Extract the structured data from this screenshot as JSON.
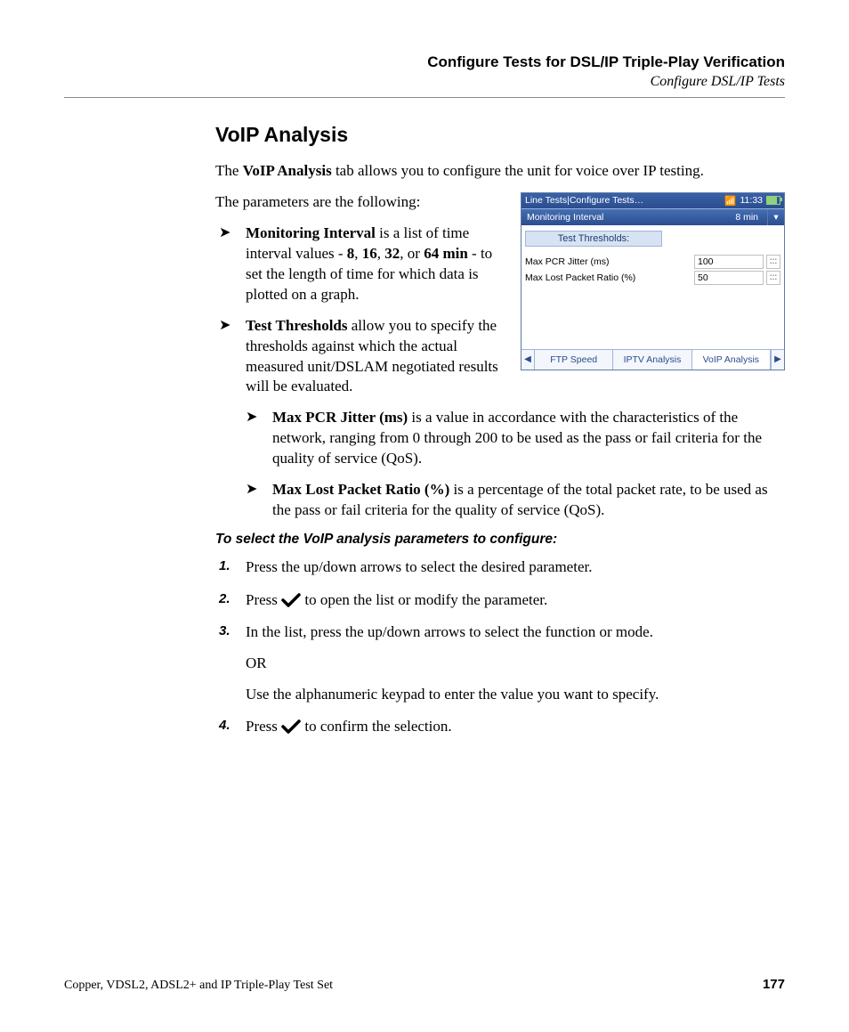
{
  "header": {
    "chapter": "Configure Tests for DSL/IP Triple-Play Verification",
    "section": "Configure DSL/IP Tests"
  },
  "title": "VoIP Analysis",
  "intro_pre": "The ",
  "intro_b": "VoIP Analysis",
  "intro_post": " tab allows you to configure the unit for voice over IP testing.",
  "params_lead": "The parameters are the following:",
  "bullets": {
    "mon_b": "Monitoring Interval",
    "mon_t1": " is a list of time interval values - ",
    "mon_v1": "8",
    "mon_c1": ", ",
    "mon_v2": "16",
    "mon_c2": ", ",
    "mon_v3": "32",
    "mon_c3": ", or ",
    "mon_v4": "64 min",
    "mon_t2": " - to set the length of time for which data is plotted on a graph.",
    "thr_b": "Test Thresholds",
    "thr_t": " allow you to specify the thresholds against which the actual measured unit/DSLAM negotiated results will be evaluated.",
    "pcr_b": "Max PCR Jitter (ms)",
    "pcr_t": " is a value in accordance with the characteristics of the network, ranging from 0 through 200 to be used as the pass or fail criteria for the quality of service (QoS).",
    "lpr_b": "Max Lost Packet Ratio (%)",
    "lpr_t": " is a percentage of the total packet rate, to be used as the pass or fail criteria for the quality of service (QoS)."
  },
  "instr_head": "To select the VoIP analysis parameters to configure:",
  "steps": {
    "s1": "Press the up/down arrows to select the desired parameter.",
    "s2a": "Press ",
    "s2b": " to open the list or modify the parameter.",
    "s3": "In the list, press the up/down arrows to select the function or mode.",
    "s3or": "OR",
    "s3alt": "Use the alphanumeric keypad to enter the value you want to specify.",
    "s4a": "Press ",
    "s4b": " to confirm the selection."
  },
  "device": {
    "breadcrumb": "Line Tests|Configure Tests…",
    "time": "11:33",
    "select_label": "Monitoring Interval",
    "select_value": "8 min",
    "thresholds_header": "Test Thresholds:",
    "rows": [
      {
        "label": "Max PCR  Jitter (ms)",
        "value": "100"
      },
      {
        "label": "Max Lost Packet Ratio (%)",
        "value": "50"
      }
    ],
    "tabs": [
      "FTP Speed",
      "IPTV Analysis",
      "VoIP Analysis"
    ]
  },
  "footer": {
    "left": "Copper, VDSL2, ADSL2+ and IP Triple-Play Test Set",
    "page": "177"
  }
}
